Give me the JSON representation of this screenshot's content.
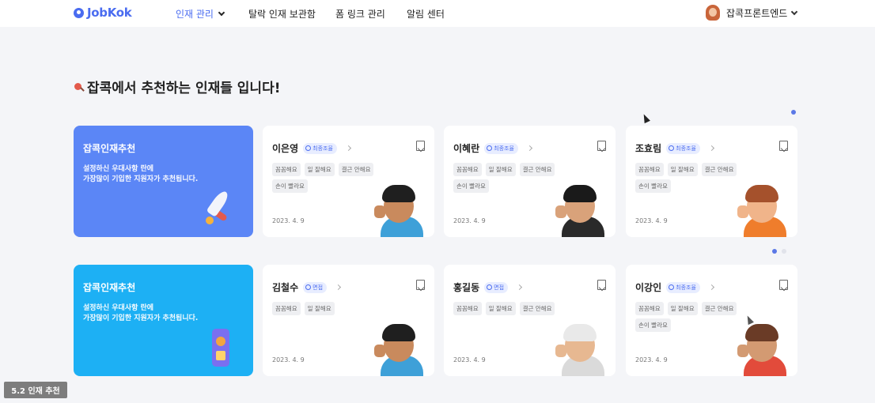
{
  "logo": {
    "text": "JobKok"
  },
  "nav": [
    {
      "label": "인재 관리",
      "active": true,
      "dropdown": true
    },
    {
      "label": "탈락 인재 보관함",
      "active": false
    },
    {
      "label": "폼 링크 관리",
      "active": false
    },
    {
      "label": "알림 센터",
      "active": false
    }
  ],
  "user": {
    "name": "잡콕프론트엔드"
  },
  "section": {
    "title": "잡콕에서 추천하는 인재들 입니다!"
  },
  "promos": [
    {
      "title": "잡콕인재추천",
      "desc_line1": "설정하신 우대사항 란에",
      "desc_line2": "가장많이 기입한 지원자가 추천됩니다.",
      "color": "#5b86f6",
      "icon": "rocket-icon"
    },
    {
      "title": "잡콕인재추천",
      "desc_line1": "설정하신 우대사항 란에",
      "desc_line2": "가장많이 기입한 지원자가 추천됩니다.",
      "color": "#1db0f4",
      "icon": "chart-phone-icon"
    }
  ],
  "rows": [
    [
      {
        "name": "이은영",
        "badge": "최종조율",
        "tags": [
          "꼼꼼해요",
          "일 잘해요",
          "결근 안해요",
          "손이 빨라요"
        ],
        "date": "2023. 4. 9",
        "avatar": {
          "skin": "#c98a5d",
          "hair": "#1f1f1f",
          "shirt": "#3ea0d8"
        }
      },
      {
        "name": "이혜란",
        "badge": "최종조율",
        "tags": [
          "꼼꼼해요",
          "일 잘해요",
          "결근 안해요",
          "손이 빨라요"
        ],
        "date": "2023. 4. 9",
        "avatar": {
          "skin": "#d9a27a",
          "hair": "#1a1a1a",
          "shirt": "#2a2a2a"
        }
      },
      {
        "name": "조효림",
        "badge": "최종조율",
        "tags": [
          "꼼꼼해요",
          "일 잘해요",
          "결근 안해요",
          "손이 빨라요"
        ],
        "date": "2023. 4. 9",
        "avatar": {
          "skin": "#f0b48a",
          "hair": "#a5512c",
          "shirt": "#ef7d2c"
        }
      }
    ],
    [
      {
        "name": "김철수",
        "badge": "면접",
        "tags": [
          "꼼꼼해요",
          "일 잘해요"
        ],
        "date": "2023. 4. 9",
        "avatar": {
          "skin": "#c98a5d",
          "hair": "#1f1f1f",
          "shirt": "#3ea0d8"
        }
      },
      {
        "name": "홍길동",
        "badge": "면접",
        "tags": [
          "꼼꼼해요",
          "일 잘해요",
          "결근 안해요"
        ],
        "date": "2023. 4. 9",
        "avatar": {
          "skin": "#e7b891",
          "hair": "#e9e9e9",
          "shirt": "#dadada"
        }
      },
      {
        "name": "이강인",
        "badge": "최종조율",
        "tags": [
          "꼼꼼해요",
          "일 잘해요",
          "결근 안해요",
          "손이 빨라요"
        ],
        "date": "2023. 4. 9",
        "avatar": {
          "skin": "#d39a72",
          "hair": "#6a3b26",
          "shirt": "#e24b3b"
        }
      }
    ]
  ],
  "footer": {
    "label": "5.2 인재 추천"
  }
}
